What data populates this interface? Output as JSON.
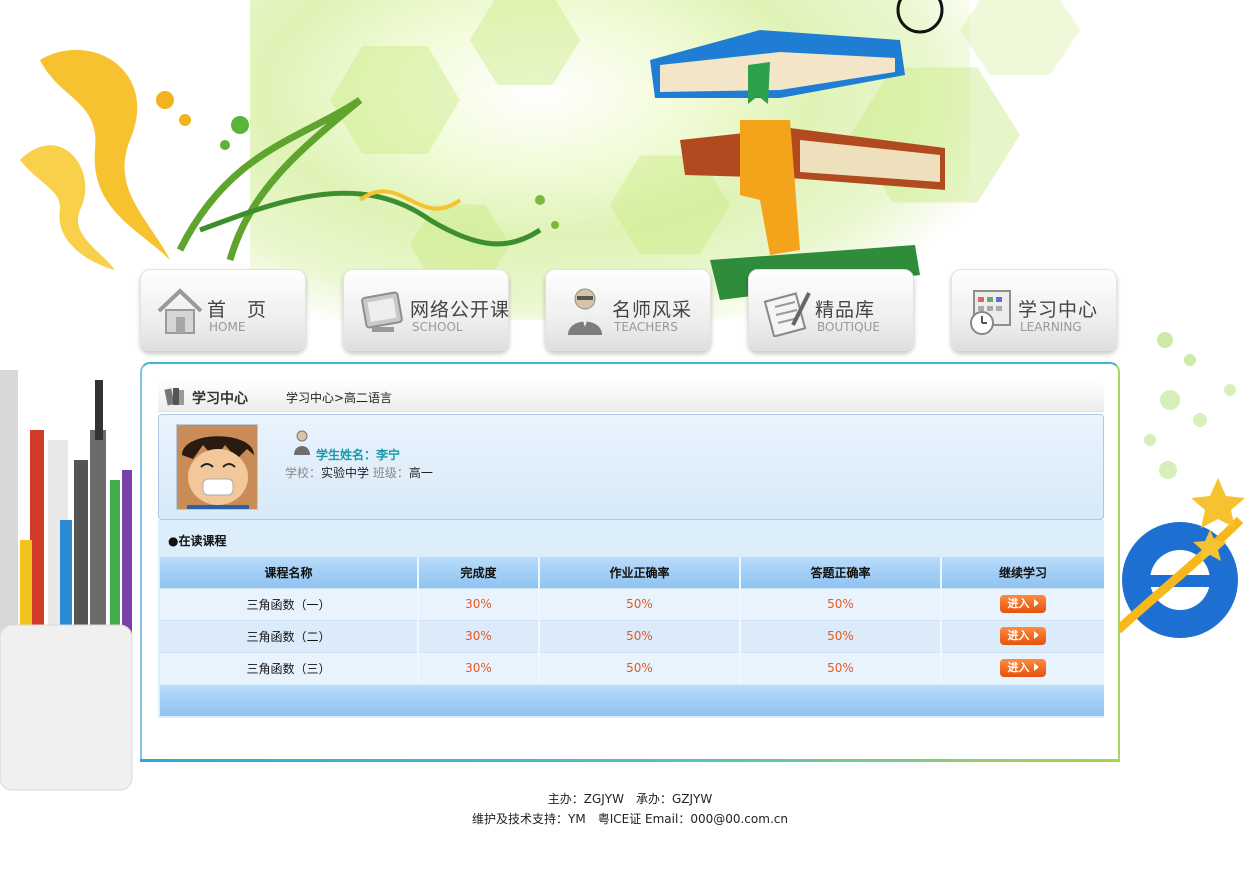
{
  "nav": [
    {
      "title": "首　页",
      "subtitle": "HOME",
      "icon": "house-icon"
    },
    {
      "title": "网络公开课",
      "subtitle": "SCHOOL",
      "icon": "monitor-icon"
    },
    {
      "title": "名师风采",
      "subtitle": "TEACHERS",
      "icon": "teacher-icon"
    },
    {
      "title": "精品库",
      "subtitle": "BOUTIQUE",
      "icon": "notebook-icon"
    },
    {
      "title": "学习中心",
      "subtitle": "LEARNING",
      "icon": "calendar-clock-icon"
    }
  ],
  "breadcrumb": {
    "title": "学习中心",
    "path": "学习中心>高二语言"
  },
  "student": {
    "name": "学生姓名：李宁",
    "school_label": "学校：",
    "school": "实验中学",
    "class_label": "班级：",
    "class": "高一"
  },
  "courses": {
    "section_title": "●在读课程",
    "columns": [
      "课程名称",
      "完成度",
      "作业正确率",
      "答题正确率",
      "继续学习"
    ],
    "rows": [
      {
        "name": "三角函数（一）",
        "completion": "30%",
        "homework": "50%",
        "answers": "50%",
        "action": "进入"
      },
      {
        "name": "三角函数（二）",
        "completion": "30%",
        "homework": "50%",
        "answers": "50%",
        "action": "进入"
      },
      {
        "name": "三角函数（三）",
        "completion": "30%",
        "homework": "50%",
        "answers": "50%",
        "action": "进入"
      }
    ]
  },
  "footer": {
    "line1": "主办：ZGJYW　承办：GZJYW",
    "line2": "维护及技术支持：YM　粤ICE证  Email：000@00.com.cn"
  },
  "colors": {
    "accent": "#41b5d8",
    "header_blue": "#8fc2f0",
    "percent": "#e45a22",
    "button": "#e4520f",
    "student_name": "#1a9aa8"
  }
}
